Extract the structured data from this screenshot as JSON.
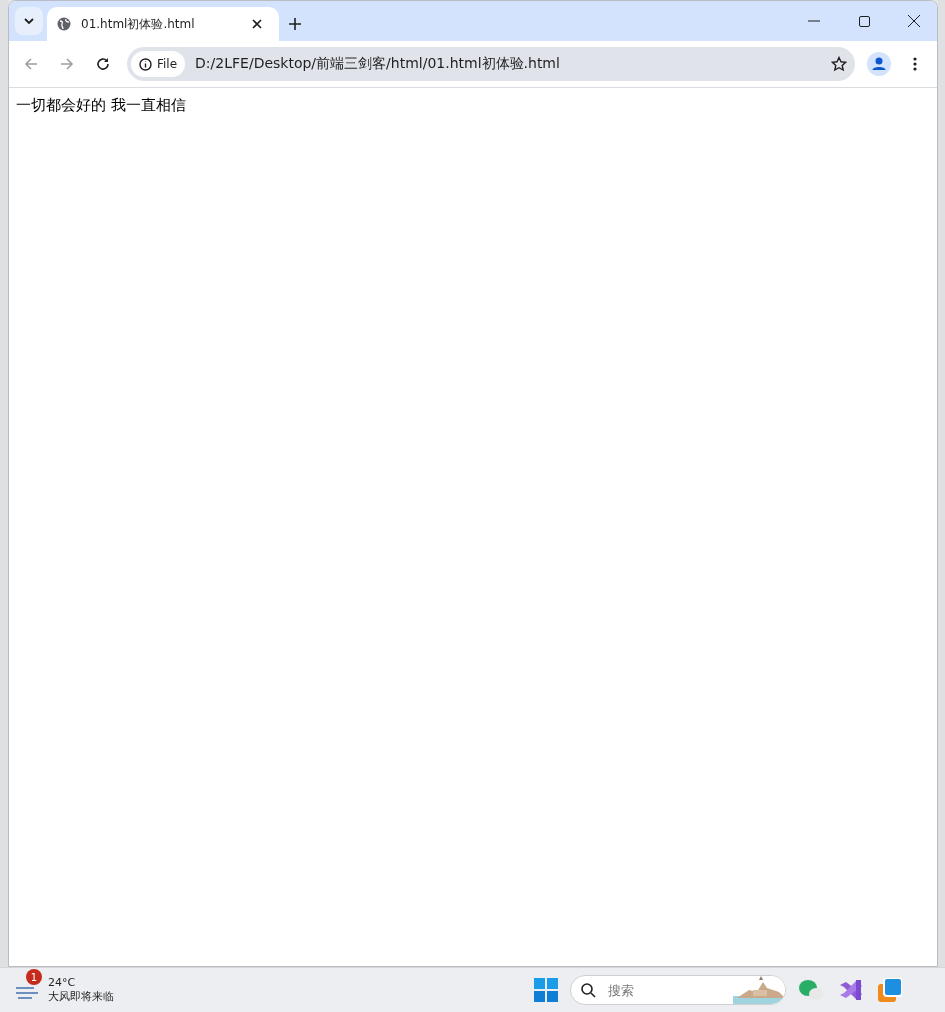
{
  "tabs": [
    {
      "title": "01.html初体验.html",
      "selected": true
    }
  ],
  "address_bar": {
    "scheme_chip": "File",
    "url": "D:/2LFE/Desktop/前端三剑客/html/01.html初体验.html"
  },
  "page": {
    "text": "一切都会好的 我一直相信"
  },
  "taskbar": {
    "weather": {
      "badge": "1",
      "temperature": "24°C",
      "condition": "大风即将来临"
    },
    "search": {
      "placeholder": "搜索"
    }
  }
}
